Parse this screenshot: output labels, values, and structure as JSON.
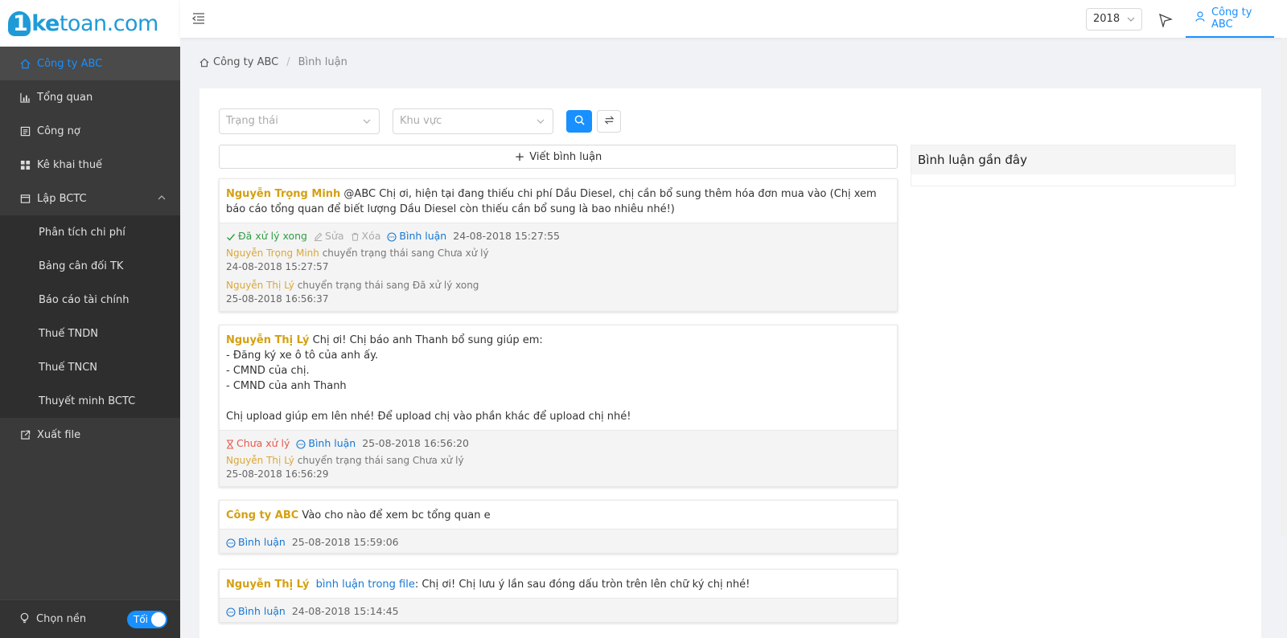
{
  "logo": {
    "one": "1",
    "ke": "ke",
    "rest": "toan.com"
  },
  "sidebar": {
    "items": [
      {
        "label": "Công ty ABC",
        "icon": "home-icon",
        "active": true
      },
      {
        "label": "Tổng quan",
        "icon": "chart-icon"
      },
      {
        "label": "Công nợ",
        "icon": "ledger-icon"
      },
      {
        "label": "Kê khai thuế",
        "icon": "grid-icon"
      },
      {
        "label": "Lập BCTC",
        "icon": "report-icon",
        "expanded": true
      }
    ],
    "submenu": [
      {
        "label": "Phân tích chi phí"
      },
      {
        "label": "Bảng cân đối TK"
      },
      {
        "label": "Báo cáo tài chính"
      },
      {
        "label": "Thuế TNDN"
      },
      {
        "label": "Thuế TNCN"
      },
      {
        "label": "Thuyết minh BCTC"
      }
    ],
    "export": {
      "label": "Xuất file",
      "icon": "export-icon"
    },
    "theme": {
      "label": "Chọn nền",
      "toggle_label": "Tối"
    }
  },
  "header": {
    "year": "2018",
    "company": "Công ty ABC"
  },
  "breadcrumb": {
    "home": "Công ty ABC",
    "current": "Bình luận"
  },
  "filters": {
    "status_placeholder": "Trạng thái",
    "region_placeholder": "Khu vực"
  },
  "write_button": "Viết bình luận",
  "recent": {
    "title": "Bình luận gần đây"
  },
  "comments": [
    {
      "author": "Nguyễn Trọng Minh",
      "text": " @ABC Chị ơi, hiện tại đang thiếu chi phí Dầu Diesel, chị cần bổ sung thêm hóa đơn mua vào (Chị xem báo cáo tổng quan để biết lượng Dầu Diesel còn thiếu cần bổ sung là bao nhiêu nhé!)",
      "status": "Đã xử lý xong",
      "edit": "Sửa",
      "delete": "Xóa",
      "comment": "Bình luận",
      "time": "24-08-2018 15:27:55",
      "logs": [
        {
          "who": "Nguyễn Trọng Minh",
          "what": " chuyển trạng thái sang Chưa xử lý",
          "time": "24-08-2018 15:27:57"
        },
        {
          "who": "Nguyễn Thị Lý",
          "what": " chuyển trạng thái sang Đã xử lý xong",
          "time": "25-08-2018 16:56:37"
        }
      ]
    },
    {
      "author": "Nguyễn Thị Lý",
      "lines": [
        " Chị ơi! Chị báo anh Thanh bổ sung giúp em:",
        "- Đăng ký xe ô tô của anh ấy.",
        "- CMND của chị.",
        "- CMND của anh Thanh",
        "",
        "Chị upload giúp em lên nhé! Để upload chị vào phần khác để upload chị nhé!"
      ],
      "status": "Chưa xử lý",
      "comment": "Bình luận",
      "time": "25-08-2018 16:56:20",
      "logs": [
        {
          "who": "Nguyễn Thị Lý",
          "what": " chuyển trạng thái sang Chưa xử lý",
          "time": "25-08-2018 16:56:29"
        }
      ]
    },
    {
      "author": "Công ty ABC",
      "text": " Vào cho nào để xem bc tổng quan e",
      "comment": "Bình luận",
      "time": "25-08-2018 15:59:06"
    },
    {
      "author": "Nguyễn Thị Lý",
      "file_link": "bình luận trong file",
      "text": ": Chị ơi! Chị lưu ý lần sau đóng dấu tròn trên lên chữ ký chị nhé!",
      "comment": "Bình luận",
      "time": "24-08-2018 15:14:45"
    }
  ]
}
